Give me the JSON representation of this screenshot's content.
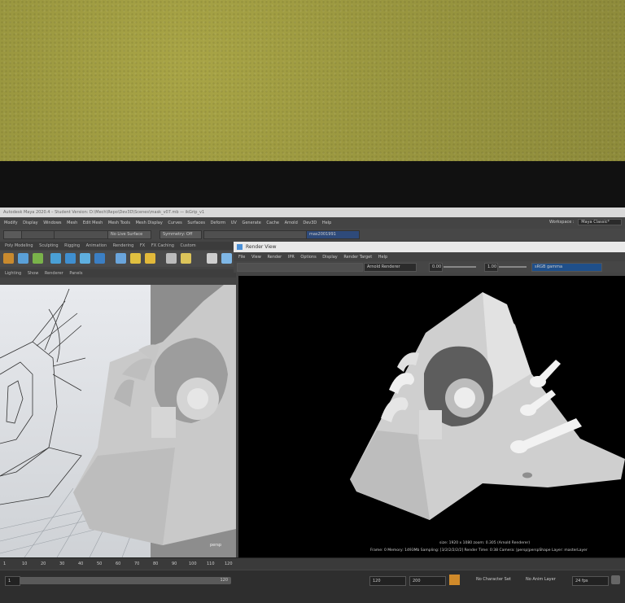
{
  "maya": {
    "title_bar": "Autodesk Maya 2020.4 – Student Version: D:\\Mech\\Repo\\Dev3D\\Scenes\\mask_v07.mb — ikGrip_v1",
    "menus": [
      "Modify",
      "Display",
      "Windows",
      "Mesh",
      "Edit Mesh",
      "Mesh Tools",
      "Mesh Display",
      "Curves",
      "Surfaces",
      "Deform",
      "UV",
      "Generate",
      "Cache",
      "Arnold",
      "Dev3D",
      "Help"
    ],
    "workspace_label": "Workspace :",
    "workspace_value": "Maya Classic*",
    "status_line": {
      "live_surface": "No Live Surface",
      "symmetry": "Symmetry: Off",
      "render_camera": "mas2001991"
    },
    "shelf_tabs": [
      "Poly Modeling",
      "Sculpting",
      "Rigging",
      "Animation",
      "Rendering",
      "FX",
      "FX Caching",
      "Custom"
    ],
    "panel_menus": [
      "Lighting",
      "Show",
      "Renderer",
      "Panels"
    ],
    "viewport_camera": "persp",
    "time_slider_ticks": [
      "1",
      "10",
      "20",
      "30",
      "40",
      "50",
      "60",
      "70",
      "80",
      "90",
      "100",
      "110",
      "120"
    ],
    "range": {
      "start": "1",
      "end": "120",
      "playback_end": "120",
      "anim_end": "200",
      "character_set": "No Character Set",
      "anim_layer": "No Anim Layer",
      "fps": "24 fps"
    }
  },
  "render_view": {
    "title": "Render View",
    "menus": [
      "File",
      "View",
      "Render",
      "IPR",
      "Options",
      "Display",
      "Render Target",
      "Help"
    ],
    "renderer": "Arnold Renderer",
    "exposure": "0.00",
    "gamma": "1.00",
    "color_space": "sRGB gamma",
    "info_line1": "size: 1920 x 1080  zoom: 0.305    (Arnold Renderer)",
    "info_line2": "Frame: 0    Memory: 1493Mb    Sampling: [3/2/2/2/2/2]    Render Time: 0:38    Camera: |persp|perspShape    Layer: masterLayer"
  },
  "colors": {
    "wall": "#9b9840",
    "render_background": "#000000",
    "model_grey": "#d8d8d8",
    "accent_blue": "#4a8fd6"
  }
}
